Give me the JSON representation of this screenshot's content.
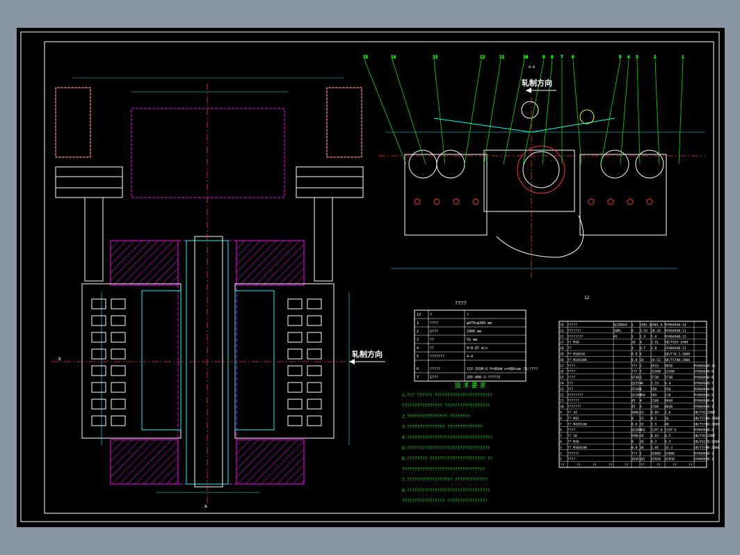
{
  "labels": {
    "rolling_direction": "轧制方向",
    "tech_req_title": "技 术 要 求",
    "param_table_title": "????",
    "section_marker": "A-A",
    "bottom_marker": "A",
    "left_marker": "B",
    "balloon_12": "12"
  },
  "balloons": [
    "15",
    "14",
    "13",
    "12",
    "11",
    "10",
    "9",
    "8",
    "7",
    "6",
    "5",
    "4",
    "3",
    "2",
    "1"
  ],
  "param_table": {
    "rows": [
      [
        "13",
        "?",
        "?"
      ],
      [
        "1",
        "????",
        "φ470×φ360   mm"
      ],
      [
        "2",
        "1???",
        "1000   mm"
      ],
      [
        "3",
        "??",
        "5%   mm"
      ],
      [
        "4",
        "??",
        "0~0.87   m/s"
      ],
      [
        "5",
        "???????",
        "4-4"
      ],
      [
        "6",
        "?????",
        "Y2Y-355M-6  P=90kW\nn=980rpm  ?1:????"
      ],
      [
        "7",
        "1???",
        "Z0Y-400-3-?????Z"
      ]
    ]
  },
  "tech_requirements": [
    "1.???  ??????  ???????????????????????",
    "  ????????????????  ??????????????????",
    "2.????????????????  ????????",
    "3.???????????????  ??????????????",
    "4.??????????????????????????????????",
    "5.?????????????????????????????????",
    "6.????????  ??????????????????????  ??",
    "  ?????????????????????????????????",
    "7.??????????????????  ?????????????",
    "8.?????????????????????????????????",
    "  ?????????????????  ????????????????"
  ],
  "bom": {
    "rows": [
      [
        "24",
        "?????",
        "QCZ80A4",
        "1",
        "1901.6",
        "1901.6",
        "RYH04940-14",
        ""
      ],
      [
        "23",
        "???????",
        "16Mn",
        "8",
        "3.53",
        "28.24",
        "RYH04940-13",
        ""
      ],
      [
        "22",
        "????????",
        "45",
        "2",
        "1.9",
        "3.8",
        "RYH04940-12",
        ""
      ],
      [
        "21",
        "?? M30",
        "",
        "20",
        "4",
        "1.91",
        "GB/T825-1988",
        ""
      ],
      [
        "20",
        "??",
        "",
        "4",
        "0.7",
        "2.8",
        "GYH04940-11",
        ""
      ],
      [
        "19",
        "?? M10X50",
        "",
        "8.8",
        "4",
        "-",
        "GB/T70.1-2000",
        ""
      ],
      [
        "18",
        "?? M24X380",
        "",
        "8.8",
        "24",
        "14.52",
        "GB/T5780-2000",
        ""
      ],
      [
        "17",
        "????",
        "",
        "???",
        "2",
        "4515",
        "9030",
        "RYH04940-10"
      ],
      [
        "16",
        "????",
        "",
        "???",
        "1",
        "12500",
        "12500",
        "GYH04940-9"
      ],
      [
        "15",
        "????",
        "",
        "QT40",
        "3",
        "5730",
        "5730",
        "RYH04940-8"
      ],
      [
        "14",
        "???",
        "",
        "Q235-A",
        "4",
        "1.53",
        "6.4",
        "RYH04940-7"
      ],
      [
        "13",
        "???",
        "",
        "HT200",
        "1",
        "550",
        "550",
        "RYH04940-6"
      ],
      [
        "12",
        "????????",
        "",
        "QCZ80A4",
        "2",
        "105",
        "210",
        "RYH04940-5"
      ],
      [
        "11",
        "??????",
        "",
        "45",
        "4",
        "2160",
        "8640",
        "RYH04940-4"
      ],
      [
        "10",
        "???????",
        "",
        "45",
        "4",
        "2160",
        "8640",
        "RYH04940-3"
      ],
      [
        "9",
        "?? 42",
        "",
        "65Mn",
        "32",
        "0.05",
        "1.6",
        "GB/T93-1987"
      ],
      [
        "8",
        "?? M42",
        "",
        "8",
        "32",
        "0.5",
        "16",
        "GB/T5780-2000"
      ],
      [
        "7",
        "?? M42X140",
        "",
        "8.8",
        "32",
        "1.5",
        "48",
        "GB/T5780-2000"
      ],
      [
        "6",
        "????",
        "",
        "QCZ80A4",
        "1",
        "1197.6",
        "1197.6",
        "RYH04940-2"
      ],
      [
        "5",
        "?? 36",
        "",
        "65Mn",
        "18",
        "0.03",
        "0.5",
        "GB/T93-1987"
      ],
      [
        "4",
        "?? M36",
        "",
        "8",
        "18",
        "0.3",
        "5.4",
        "GB/T6170-2000"
      ],
      [
        "3",
        "?? M36X190",
        "",
        "8.8",
        "18",
        "1.85",
        "33.3",
        "GB/T5780-2000"
      ],
      [
        "2",
        "??????",
        "",
        "???",
        "1",
        "15000",
        "15000",
        "RYH04940-1"
      ],
      [
        "1",
        "????",
        "",
        "ZG45-II",
        "1",
        "52930",
        "52930",
        "GYH04940-1"
      ]
    ],
    "header": [
      "??",
      "??",
      "??",
      "??",
      "??",
      "??",
      "??",
      "??",
      "??"
    ]
  },
  "colors": {
    "background": "#000000",
    "frame": "#ffffff",
    "window_bg": "#8a96a3",
    "hatch": "#ff00ff",
    "center_line": "#ff3030",
    "dim": "#00ffff",
    "leader": "#00ff00",
    "text_green": "#00ff00",
    "part_outline": "#ffffff",
    "yellow": "#ffff00"
  }
}
